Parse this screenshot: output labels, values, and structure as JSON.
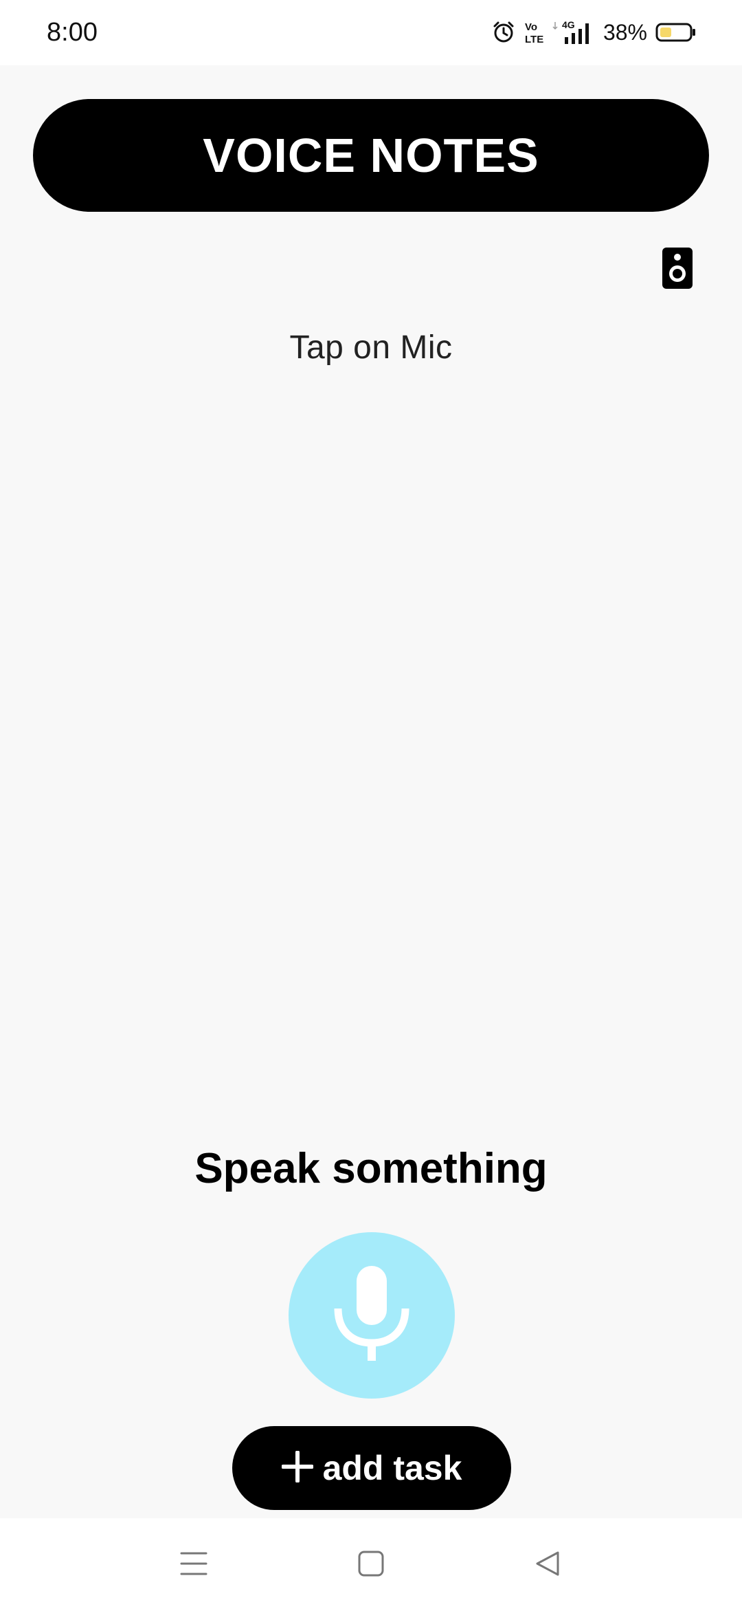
{
  "status_bar": {
    "time": "8:00",
    "battery_percent": "38%",
    "network": "4G",
    "volte_top": "Vo",
    "volte_bottom": "LTE",
    "icons": [
      "alarm-icon",
      "volte-icon",
      "signal-icon",
      "battery-icon"
    ]
  },
  "header": {
    "title": "VOICE NOTES"
  },
  "toolbar": {
    "speaker_icon": "speaker-icon"
  },
  "main": {
    "hint": "Tap on Mic",
    "speak_label": "Speak something"
  },
  "mic": {
    "icon": "microphone-icon"
  },
  "add_task": {
    "label": "add task",
    "icon": "plus-icon"
  },
  "nav": {
    "items": [
      "menu-icon",
      "home-icon",
      "back-icon"
    ]
  },
  "colors": {
    "background": "#f8f8f8",
    "header_bg": "#000000",
    "mic_bg": "#a5ebfa",
    "battery_fill": "#f6d86a"
  }
}
